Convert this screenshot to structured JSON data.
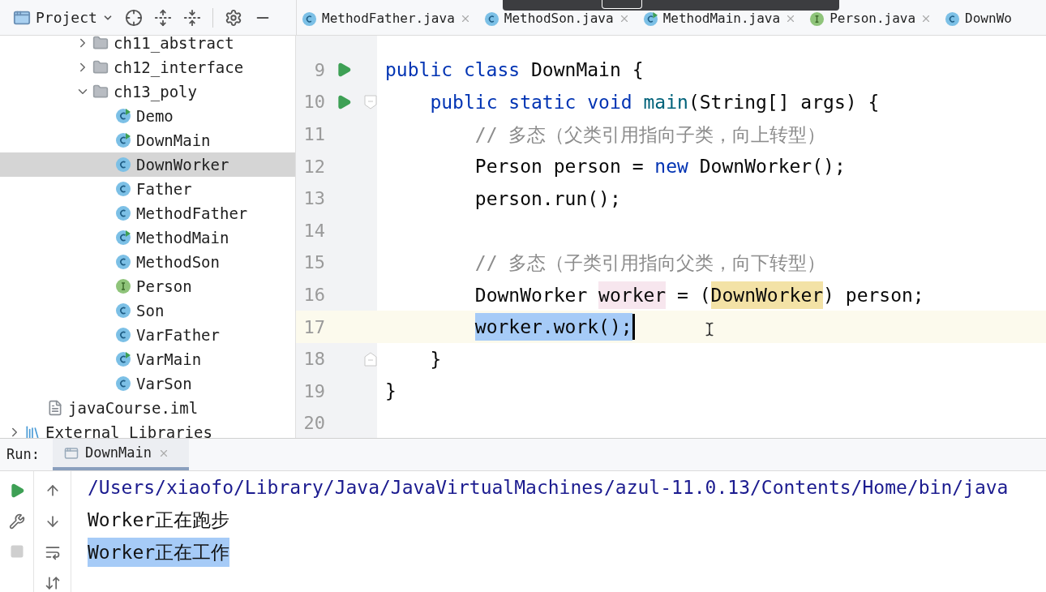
{
  "toolbar": {
    "title": "Project"
  },
  "tabs": [
    {
      "label": "MethodFather.java",
      "kind": "class",
      "closable": true,
      "selected": false
    },
    {
      "label": "MethodSon.java",
      "kind": "class",
      "closable": true,
      "selected": false
    },
    {
      "label": "MethodMain.java",
      "kind": "runnable",
      "closable": true,
      "selected": false
    },
    {
      "label": "Person.java",
      "kind": "interface",
      "closable": true,
      "selected": false
    },
    {
      "label": "DownWo",
      "kind": "class",
      "closable": false,
      "selected": false
    }
  ],
  "tree": [
    {
      "children": [
        {
          "children": [
            {
              "children": [
                {
                  "label": "ch11_abstract",
                  "kind": "folder",
                  "expanded": false,
                  "selected": false
                },
                {
                  "label": "ch12_interface",
                  "kind": "folder",
                  "expanded": false,
                  "selected": false
                },
                {
                  "label": "ch13_poly",
                  "kind": "folder",
                  "expanded": true,
                  "selected": false,
                  "children": [
                    {
                      "label": "Demo",
                      "kind": "runnable",
                      "selected": false
                    },
                    {
                      "label": "DownMain",
                      "kind": "runnable",
                      "selected": false
                    },
                    {
                      "label": "DownWorker",
                      "kind": "class",
                      "selected": true
                    },
                    {
                      "label": "Father",
                      "kind": "class",
                      "selected": false
                    },
                    {
                      "label": "MethodFather",
                      "kind": "class",
                      "selected": false
                    },
                    {
                      "label": "MethodMain",
                      "kind": "runnable",
                      "selected": false
                    },
                    {
                      "label": "MethodSon",
                      "kind": "class",
                      "selected": false
                    },
                    {
                      "label": "Person",
                      "kind": "interface",
                      "selected": false
                    },
                    {
                      "label": "Son",
                      "kind": "class",
                      "selected": false
                    },
                    {
                      "label": "VarFather",
                      "kind": "class",
                      "selected": false
                    },
                    {
                      "label": "VarMain",
                      "kind": "runnable",
                      "selected": false
                    },
                    {
                      "label": "VarSon",
                      "kind": "class",
                      "selected": false
                    }
                  ]
                }
              ]
            }
          ]
        },
        {
          "label": "javaCourse.iml",
          "kind": "file",
          "selected": false
        }
      ]
    },
    {
      "label": "External Libraries",
      "kind": "library",
      "expanded": false,
      "selected": false
    }
  ],
  "editor": {
    "lines": [
      {
        "number": "9",
        "run": true,
        "tokens": [
          {
            "text": "public class ",
            "kind": "keyword"
          },
          {
            "text": "DownMain {",
            "kind": "plain"
          }
        ]
      },
      {
        "number": "10",
        "run": true,
        "fold_open": true,
        "tokens": [
          {
            "text": "    public static void ",
            "kind": "keyword"
          },
          {
            "text": "main",
            "kind": "declaration"
          },
          {
            "text": "(String[] args) {",
            "kind": "plain"
          }
        ]
      },
      {
        "number": "11",
        "tokens": [
          {
            "text": "        // 多态（父类引用指向子类，向上转型）",
            "kind": "comment"
          }
        ]
      },
      {
        "number": "12",
        "tokens": [
          {
            "text": "        Person person = ",
            "kind": "plain"
          },
          {
            "text": "new",
            "kind": "keyword"
          },
          {
            "text": " DownWorker();",
            "kind": "plain"
          }
        ]
      },
      {
        "number": "13",
        "tokens": [
          {
            "text": "        person.run();",
            "kind": "plain"
          }
        ]
      },
      {
        "number": "14"
      },
      {
        "number": "15",
        "tokens": [
          {
            "text": "        // 多态（子类引用指向父类，向下转型）",
            "kind": "comment"
          }
        ]
      },
      {
        "number": "16",
        "tokens": [
          {
            "text": "        DownWorker ",
            "kind": "plain"
          },
          {
            "text": "worker",
            "kind": "usage"
          },
          {
            "text": " = (",
            "kind": "plain"
          },
          {
            "text": "DownWorker",
            "kind": "cast"
          },
          {
            "text": ") person;",
            "kind": "plain"
          }
        ]
      },
      {
        "number": "17",
        "current": true,
        "caret": true,
        "tokens": [
          {
            "text": "        worker.work();",
            "kind": "selected"
          }
        ]
      },
      {
        "number": "18",
        "fold_close": true,
        "tokens": [
          {
            "text": "    }",
            "kind": "plain"
          }
        ]
      },
      {
        "number": "19",
        "tokens": [
          {
            "text": "}",
            "kind": "plain"
          }
        ]
      },
      {
        "number": "20"
      }
    ]
  },
  "run_panel": {
    "label": "Run:",
    "tabs": [
      {
        "label": "DownMain",
        "selected": true
      }
    ],
    "console": [
      {
        "text": "/Users/xiaofo/Library/Java/JavaVirtualMachines/azul-11.0.13/Contents/Home/bin/java",
        "kind": "path",
        "selected": false
      },
      {
        "text": "Worker正在跑步",
        "kind": "output",
        "selected": false
      },
      {
        "text": "Worker正在工作",
        "kind": "output",
        "selected": true
      }
    ]
  }
}
